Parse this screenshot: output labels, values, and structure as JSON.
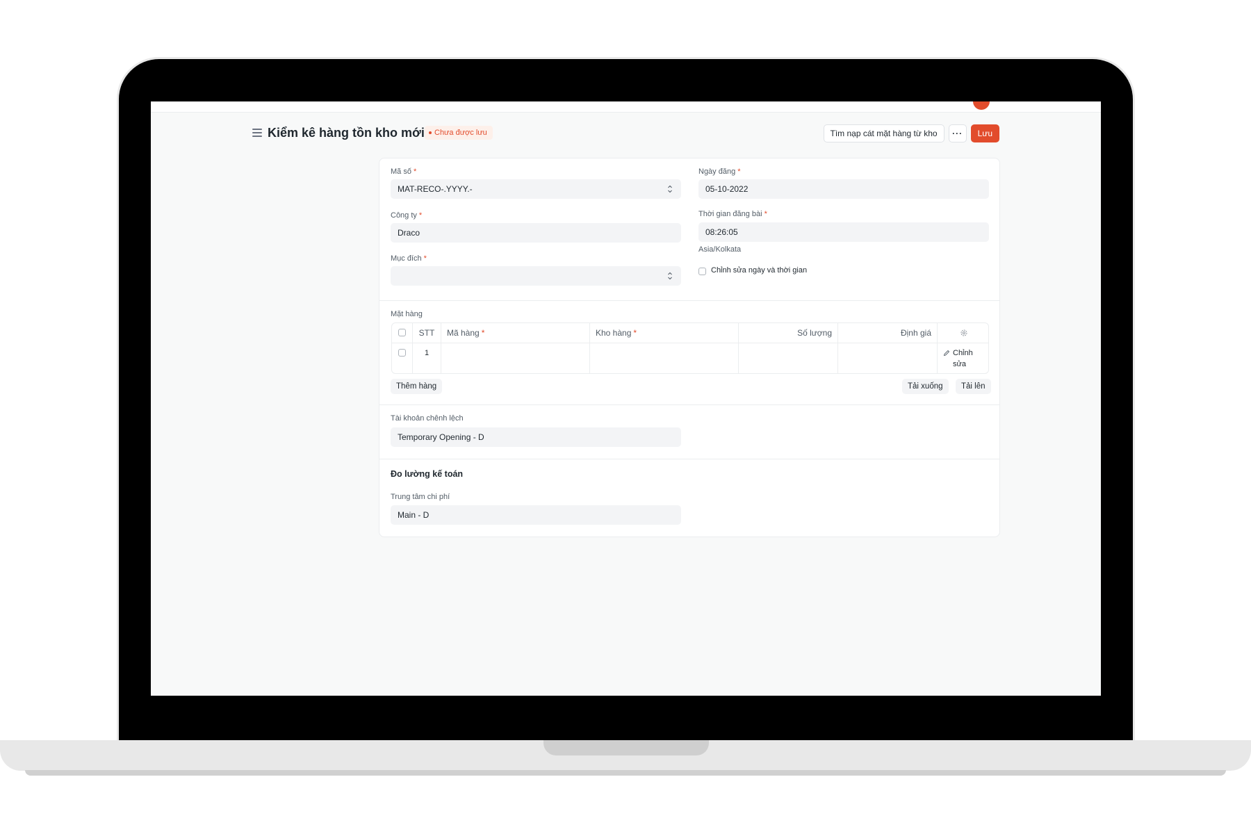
{
  "page": {
    "title": "Kiểm kê hàng tồn kho mới",
    "status": "Chưa được lưu",
    "actions": {
      "fetch_label": "Tìm nạp cát mặt hàng từ kho",
      "more_label": "···",
      "save_label": "Lưu"
    }
  },
  "form": {
    "series": {
      "label": "Mã số",
      "value": "MAT-RECO-.YYYY.-"
    },
    "posting_date": {
      "label": "Ngày đăng",
      "value": "05-10-2022"
    },
    "company": {
      "label": "Công ty",
      "value": "Draco"
    },
    "posting_time": {
      "label": "Thời gian đăng bài",
      "value": "08:26:05",
      "timezone": "Asia/Kolkata"
    },
    "purpose": {
      "label": "Mục đích",
      "value": ""
    },
    "edit_datetime": {
      "label": "Chỉnh sửa ngày và thời gian",
      "checked": false
    }
  },
  "items": {
    "label": "Mặt hàng",
    "columns": {
      "no": "STT",
      "item_code": "Mã hàng",
      "warehouse": "Kho hàng",
      "qty": "Số lượng",
      "valuation": "Định giá"
    },
    "rows": [
      {
        "no": "1",
        "item_code": "",
        "warehouse": "",
        "qty": "",
        "valuation": "",
        "edit": "Chỉnh sửa"
      }
    ],
    "add_row": "Thêm hàng",
    "download": "Tải xuống",
    "upload": "Tải lên"
  },
  "difference_account": {
    "label": "Tài khoản chênh lệch",
    "value": "Temporary Opening - D"
  },
  "accounting_dimensions": {
    "title": "Đo lường kế toán",
    "cost_center": {
      "label": "Trung tâm chi phí",
      "value": "Main - D"
    }
  },
  "colors": {
    "accent": "#e24c2c",
    "control_bg": "#f3f4f6",
    "page_bg": "#f8f9f9"
  }
}
